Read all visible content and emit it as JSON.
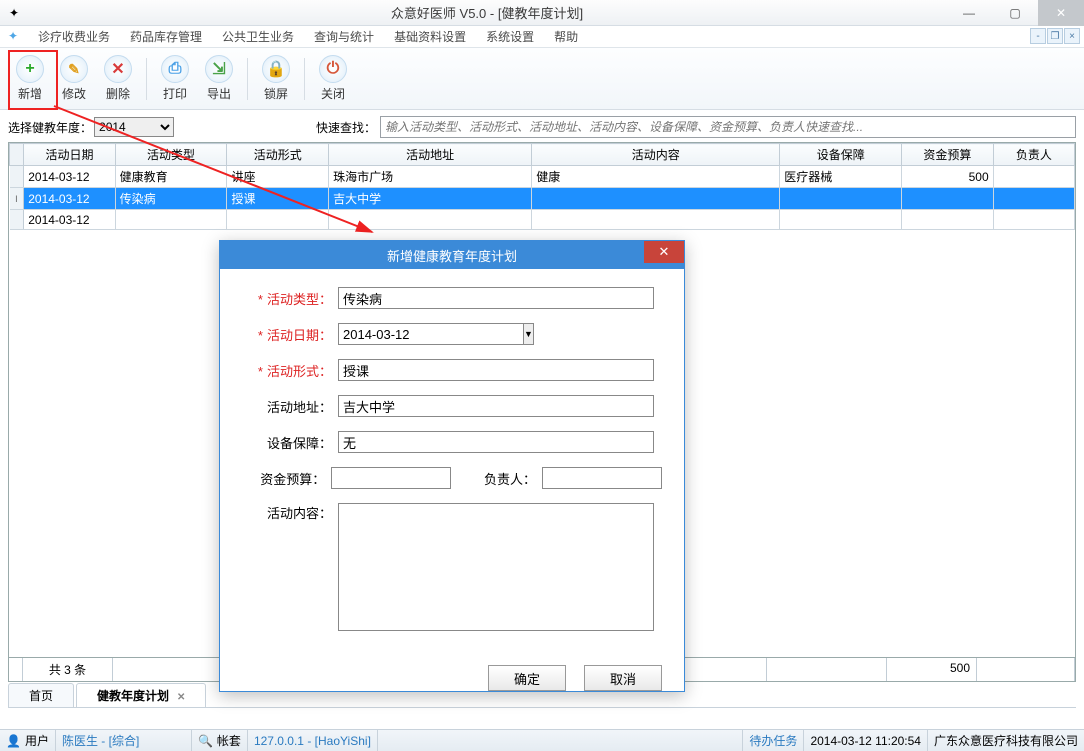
{
  "window": {
    "title": "众意好医师 V5.0 - [健教年度计划]"
  },
  "menu": {
    "items": [
      "诊疗收费业务",
      "药品库存管理",
      "公共卫生业务",
      "查询与统计",
      "基础资料设置",
      "系统设置",
      "帮助"
    ]
  },
  "toolbar": {
    "add": "新增",
    "modify": "修改",
    "delete": "删除",
    "print": "打印",
    "export": "导出",
    "lock": "锁屏",
    "close": "关闭"
  },
  "filter": {
    "year_label": "选择健教年度：",
    "year_value": "2014",
    "quick_label": "快速查找：",
    "quick_placeholder": "输入活动类型、活动形式、活动地址、活动内容、设备保障、资金预算、负责人快速查找..."
  },
  "columns": [
    "活动日期",
    "活动类型",
    "活动形式",
    "活动地址",
    "活动内容",
    "设备保障",
    "资金预算",
    "负责人"
  ],
  "rows": [
    {
      "date": "2014-03-12",
      "type": "健康教育",
      "form": "讲座",
      "addr": "珠海市广场",
      "content": "健康",
      "equip": "医疗器械",
      "budget": "500",
      "owner": ""
    },
    {
      "date": "2014-03-12",
      "type": "传染病",
      "form": "授课",
      "addr": "吉大中学",
      "content": "",
      "equip": "",
      "budget": "",
      "owner": ""
    },
    {
      "date": "2014-03-12",
      "type": "",
      "form": "",
      "addr": "",
      "content": "",
      "equip": "",
      "budget": "",
      "owner": ""
    }
  ],
  "summary": {
    "count_label": "共 3 条",
    "budget_total": "500"
  },
  "tabs": {
    "home": "首页",
    "active": "健教年度计划"
  },
  "status": {
    "user_label": "用户",
    "user_value": "陈医生 - [综合]",
    "db_label": "帐套",
    "db_value": "127.0.0.1 - [HaoYiShi]",
    "todo": "待办任务",
    "datetime": "2014-03-12 11:20:54",
    "company": "广东众意医疗科技有限公司"
  },
  "dialog": {
    "title": "新增健康教育年度计划",
    "type_label": "活动类型：",
    "type_value": "传染病",
    "date_label": "活动日期：",
    "date_value": "2014-03-12",
    "form_label": "活动形式：",
    "form_value": "授课",
    "addr_label": "活动地址：",
    "addr_value": "吉大中学",
    "equip_label": "设备保障：",
    "equip_value": "无",
    "budget_label": "资金预算：",
    "budget_value": "",
    "owner_label": "负责人：",
    "owner_value": "",
    "content_label": "活动内容：",
    "content_value": "",
    "ok": "确定",
    "cancel": "取消"
  }
}
